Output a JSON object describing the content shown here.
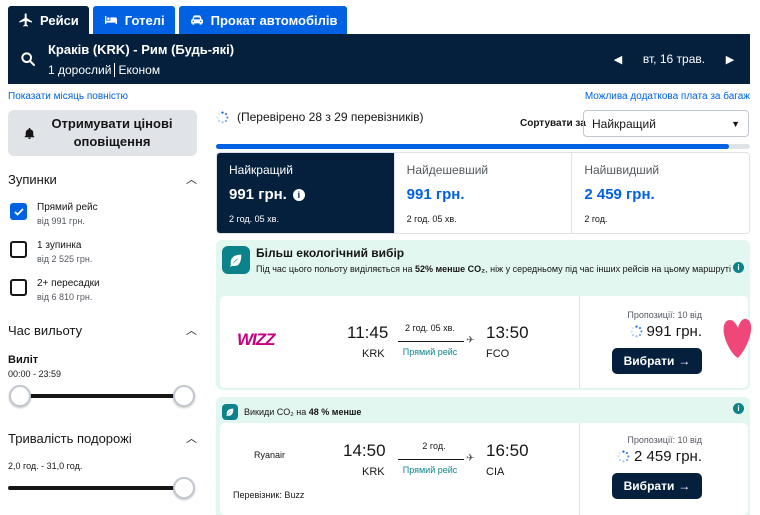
{
  "tabs": [
    {
      "label": "Рейси",
      "icon": "plane-icon",
      "active": true
    },
    {
      "label": "Готелі",
      "icon": "bed-icon",
      "active": false
    },
    {
      "label": "Прокат автомобілів",
      "icon": "car-icon",
      "active": false
    }
  ],
  "search": {
    "route": "Краків (KRK) - Рим (Будь-які)",
    "passengers": "1 дорослий",
    "cabin": "Економ",
    "date": "вт, 16 трав."
  },
  "links": {
    "month": "Показати місяць повністю",
    "fees": "Можлива додаткова плата за багаж"
  },
  "sidebar": {
    "alert_label": "Отримувати цінові оповіщення",
    "stops_title": "Зупинки",
    "stops": [
      {
        "label": "Прямий рейс",
        "price": "від 991 грн.",
        "checked": true
      },
      {
        "label": "1 зупинка",
        "price": "від 2 525 грн.",
        "checked": false
      },
      {
        "label": "2+ пересадки",
        "price": "від 6 810 грн.",
        "checked": false
      }
    ],
    "departure_title": "Час вильоту",
    "departure_sub": "Виліт",
    "departure_range": "00:00 - 23:59",
    "duration_title": "Тривалість подорожі",
    "duration_range": "2,0 год. - 31,0 год."
  },
  "main": {
    "checked_text": "(Перевірено 28 з 29 перевізників)",
    "sort_label": "Сортувати за",
    "sort_value": "Найкращий",
    "progress": 0.96,
    "price_tabs": [
      {
        "label": "Найкращий",
        "price": "991 грн.",
        "duration": "2 год. 05 хв.",
        "active": true
      },
      {
        "label": "Найдешевший",
        "price": "991 грн.",
        "duration": "2 год. 05 хв.",
        "active": false
      },
      {
        "label": "Найшвидший",
        "price": "2 459 грн.",
        "duration": "2 год.",
        "active": false
      }
    ]
  },
  "results": [
    {
      "eco_title": "Більш екологічний вибір",
      "eco_text_1": "Під час цього польоту виділяється на",
      "eco_highlight": "52% менше CO₂",
      "eco_text_2": ", ніж у середньому під час інших рейсів на цьому маршруті",
      "airline": "WIZZ",
      "dep_time": "11:45",
      "dep_airport": "KRK",
      "duration": "2 год. 05 хв.",
      "stops": "Прямий рейс",
      "arr_time": "13:50",
      "arr_airport": "FCO",
      "offers": "Пропозиції: 10 від",
      "price": "991 грн.",
      "button": "Вибрати"
    },
    {
      "co2_prefix": "Викиди CO₂ на",
      "co2_highlight": "48 % менше",
      "airline": "Ryanair",
      "dep_time": "14:50",
      "dep_airport": "KRK",
      "duration": "2 год.",
      "stops": "Прямий рейс",
      "arr_time": "16:50",
      "arr_airport": "CIA",
      "carrier": "Перевізник: Buzz",
      "offers": "Пропозиції: 10 від",
      "price": "2 459 грн.",
      "button": "Вибрати"
    }
  ],
  "colors": {
    "navy": "#05203c",
    "blue": "#0062e3",
    "eco": "#e3f7f1",
    "teal": "#0c838a",
    "heart": "#f0477a"
  }
}
